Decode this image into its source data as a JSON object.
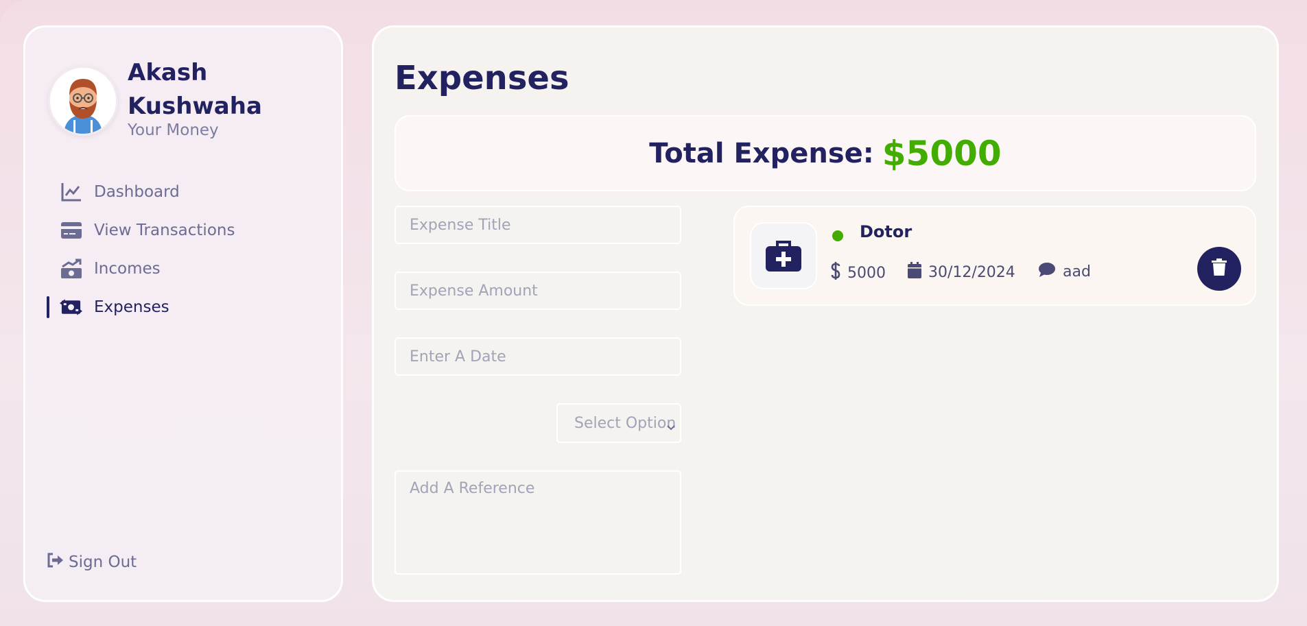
{
  "user": {
    "name": "Akash Kushwaha",
    "subtitle": "Your Money"
  },
  "nav": {
    "items": [
      {
        "label": "Dashboard",
        "icon": "chart-line-icon",
        "active": false
      },
      {
        "label": "View Transactions",
        "icon": "credit-card-icon",
        "active": false
      },
      {
        "label": "Incomes",
        "icon": "money-bill-trend-up-icon",
        "active": false
      },
      {
        "label": "Expenses",
        "icon": "money-bill-transfer-icon",
        "active": true
      }
    ],
    "signout": "Sign Out"
  },
  "page": {
    "title": "Expenses"
  },
  "total": {
    "label": "Total Expense:",
    "amount": "$5000"
  },
  "form": {
    "title_placeholder": "Expense Title",
    "amount_placeholder": "Expense Amount",
    "date_placeholder": "Enter A Date",
    "select_label": "Select Option",
    "reference_placeholder": "Add A Reference"
  },
  "expenses": [
    {
      "title": "Dotor",
      "amount": "5000",
      "date": "30/12/2024",
      "note": "aad",
      "icon": "medical-kit-icon",
      "status_color": "#42ad00"
    }
  ],
  "colors": {
    "primary": "#222260",
    "accent_green": "#42ad00",
    "muted": "#6c6c92"
  }
}
